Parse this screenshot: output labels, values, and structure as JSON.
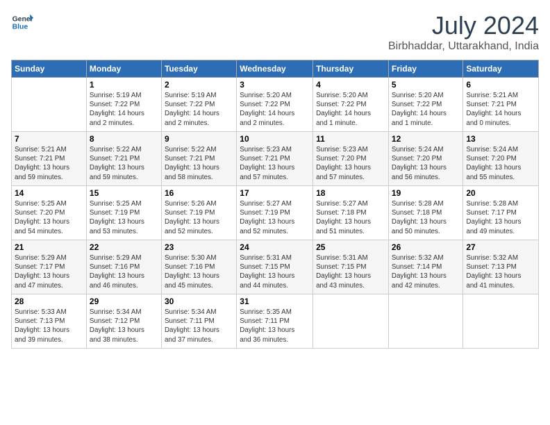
{
  "logo": {
    "line1": "General",
    "line2": "Blue"
  },
  "title": "July 2024",
  "location": "Birbhaddar, Uttarakhand, India",
  "days_header": [
    "Sunday",
    "Monday",
    "Tuesday",
    "Wednesday",
    "Thursday",
    "Friday",
    "Saturday"
  ],
  "weeks": [
    [
      {
        "num": "",
        "info": ""
      },
      {
        "num": "1",
        "info": "Sunrise: 5:19 AM\nSunset: 7:22 PM\nDaylight: 14 hours\nand 2 minutes."
      },
      {
        "num": "2",
        "info": "Sunrise: 5:19 AM\nSunset: 7:22 PM\nDaylight: 14 hours\nand 2 minutes."
      },
      {
        "num": "3",
        "info": "Sunrise: 5:20 AM\nSunset: 7:22 PM\nDaylight: 14 hours\nand 2 minutes."
      },
      {
        "num": "4",
        "info": "Sunrise: 5:20 AM\nSunset: 7:22 PM\nDaylight: 14 hours\nand 1 minute."
      },
      {
        "num": "5",
        "info": "Sunrise: 5:20 AM\nSunset: 7:22 PM\nDaylight: 14 hours\nand 1 minute."
      },
      {
        "num": "6",
        "info": "Sunrise: 5:21 AM\nSunset: 7:21 PM\nDaylight: 14 hours\nand 0 minutes."
      }
    ],
    [
      {
        "num": "7",
        "info": "Sunrise: 5:21 AM\nSunset: 7:21 PM\nDaylight: 13 hours\nand 59 minutes."
      },
      {
        "num": "8",
        "info": "Sunrise: 5:22 AM\nSunset: 7:21 PM\nDaylight: 13 hours\nand 59 minutes."
      },
      {
        "num": "9",
        "info": "Sunrise: 5:22 AM\nSunset: 7:21 PM\nDaylight: 13 hours\nand 58 minutes."
      },
      {
        "num": "10",
        "info": "Sunrise: 5:23 AM\nSunset: 7:21 PM\nDaylight: 13 hours\nand 57 minutes."
      },
      {
        "num": "11",
        "info": "Sunrise: 5:23 AM\nSunset: 7:20 PM\nDaylight: 13 hours\nand 57 minutes."
      },
      {
        "num": "12",
        "info": "Sunrise: 5:24 AM\nSunset: 7:20 PM\nDaylight: 13 hours\nand 56 minutes."
      },
      {
        "num": "13",
        "info": "Sunrise: 5:24 AM\nSunset: 7:20 PM\nDaylight: 13 hours\nand 55 minutes."
      }
    ],
    [
      {
        "num": "14",
        "info": "Sunrise: 5:25 AM\nSunset: 7:20 PM\nDaylight: 13 hours\nand 54 minutes."
      },
      {
        "num": "15",
        "info": "Sunrise: 5:25 AM\nSunset: 7:19 PM\nDaylight: 13 hours\nand 53 minutes."
      },
      {
        "num": "16",
        "info": "Sunrise: 5:26 AM\nSunset: 7:19 PM\nDaylight: 13 hours\nand 52 minutes."
      },
      {
        "num": "17",
        "info": "Sunrise: 5:27 AM\nSunset: 7:19 PM\nDaylight: 13 hours\nand 52 minutes."
      },
      {
        "num": "18",
        "info": "Sunrise: 5:27 AM\nSunset: 7:18 PM\nDaylight: 13 hours\nand 51 minutes."
      },
      {
        "num": "19",
        "info": "Sunrise: 5:28 AM\nSunset: 7:18 PM\nDaylight: 13 hours\nand 50 minutes."
      },
      {
        "num": "20",
        "info": "Sunrise: 5:28 AM\nSunset: 7:17 PM\nDaylight: 13 hours\nand 49 minutes."
      }
    ],
    [
      {
        "num": "21",
        "info": "Sunrise: 5:29 AM\nSunset: 7:17 PM\nDaylight: 13 hours\nand 47 minutes."
      },
      {
        "num": "22",
        "info": "Sunrise: 5:29 AM\nSunset: 7:16 PM\nDaylight: 13 hours\nand 46 minutes."
      },
      {
        "num": "23",
        "info": "Sunrise: 5:30 AM\nSunset: 7:16 PM\nDaylight: 13 hours\nand 45 minutes."
      },
      {
        "num": "24",
        "info": "Sunrise: 5:31 AM\nSunset: 7:15 PM\nDaylight: 13 hours\nand 44 minutes."
      },
      {
        "num": "25",
        "info": "Sunrise: 5:31 AM\nSunset: 7:15 PM\nDaylight: 13 hours\nand 43 minutes."
      },
      {
        "num": "26",
        "info": "Sunrise: 5:32 AM\nSunset: 7:14 PM\nDaylight: 13 hours\nand 42 minutes."
      },
      {
        "num": "27",
        "info": "Sunrise: 5:32 AM\nSunset: 7:13 PM\nDaylight: 13 hours\nand 41 minutes."
      }
    ],
    [
      {
        "num": "28",
        "info": "Sunrise: 5:33 AM\nSunset: 7:13 PM\nDaylight: 13 hours\nand 39 minutes."
      },
      {
        "num": "29",
        "info": "Sunrise: 5:34 AM\nSunset: 7:12 PM\nDaylight: 13 hours\nand 38 minutes."
      },
      {
        "num": "30",
        "info": "Sunrise: 5:34 AM\nSunset: 7:11 PM\nDaylight: 13 hours\nand 37 minutes."
      },
      {
        "num": "31",
        "info": "Sunrise: 5:35 AM\nSunset: 7:11 PM\nDaylight: 13 hours\nand 36 minutes."
      },
      {
        "num": "",
        "info": ""
      },
      {
        "num": "",
        "info": ""
      },
      {
        "num": "",
        "info": ""
      }
    ]
  ]
}
